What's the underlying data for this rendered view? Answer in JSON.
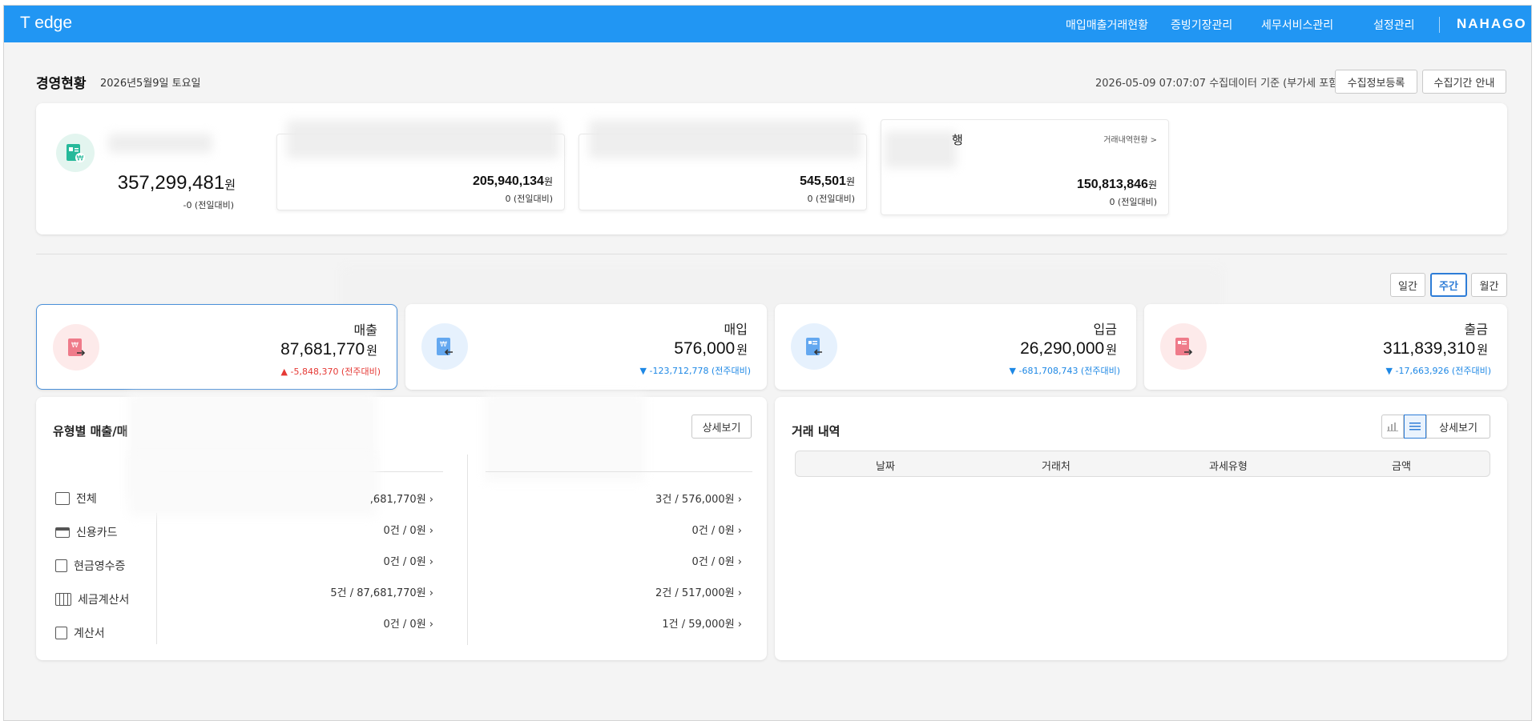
{
  "topbar": {
    "brand": "T edge",
    "nav": [
      "매입매출거래현황",
      "증빙기장관리",
      "세무서비스관리",
      "설정관리"
    ],
    "logo": "NAHAGO"
  },
  "header": {
    "title": "경영현황",
    "date": "2026년5월9일 토요일",
    "collect_info": "2026-05-09 07:07:07 수집데이터 기준 (부가세 포함)",
    "btn_register": "수집정보등록",
    "btn_period": "수집기간 안내"
  },
  "balances": {
    "total": {
      "value": "357,299,481",
      "unit": "원",
      "change": "-0 (전일대비)"
    },
    "accounts": [
      {
        "value": "205,940,134",
        "unit": "원",
        "change": "0 (전일대비)",
        "name_visible": "",
        "link": ""
      },
      {
        "value": "545,501",
        "unit": "원",
        "change": "0 (전일대비)",
        "name_visible": "",
        "link": ""
      },
      {
        "value": "150,813,846",
        "unit": "원",
        "change": "0 (전일대비)",
        "name_visible": "행",
        "link": "거래내역현황 >"
      }
    ]
  },
  "period_tabs": [
    "일간",
    "주간",
    "월간"
  ],
  "period_selected": "주간",
  "stats": [
    {
      "label": "매출",
      "value": "87,681,770",
      "unit": "원",
      "change": "▲ -5,848,370 (전주대비)",
      "dir": "up",
      "color": "#e57373"
    },
    {
      "label": "매입",
      "value": "576,000",
      "unit": "원",
      "change": "▼ -123,712,778 (전주대비)",
      "dir": "down",
      "color": "#64a8f0"
    },
    {
      "label": "입금",
      "value": "26,290,000",
      "unit": "원",
      "change": "▼ -681,708,743 (전주대비)",
      "dir": "down",
      "color": "#64a8f0"
    },
    {
      "label": "출금",
      "value": "311,839,310",
      "unit": "원",
      "change": "▼ -17,663,926 (전주대비)",
      "dir": "down",
      "color": "#e57373"
    }
  ],
  "type_panel": {
    "title": "유형별 매출/매",
    "detail_btn": "상세보기",
    "rows": [
      {
        "label": "전체",
        "icon": "clipboard-icon",
        "sales": ",681,770원",
        "purchase": "3건 / 576,000원"
      },
      {
        "label": "신용카드",
        "icon": "credit-card-icon",
        "sales": "0건 / 0원",
        "purchase": "0건 / 0원"
      },
      {
        "label": "현금영수증",
        "icon": "receipt-icon",
        "sales": "0건 / 0원",
        "purchase": "0건 / 0원"
      },
      {
        "label": "세금계산서",
        "icon": "tax-invoice-icon",
        "sales": "5건 / 87,681,770원",
        "purchase": "2건 / 517,000원"
      },
      {
        "label": "계산서",
        "icon": "invoice-icon",
        "sales": "0건 / 0원",
        "purchase": "1건 / 59,000원"
      }
    ]
  },
  "tx_panel": {
    "title": "거래 내역",
    "detail_btn": "상세보기",
    "columns": [
      "날짜",
      "거래처",
      "과세유형",
      "금액"
    ]
  }
}
